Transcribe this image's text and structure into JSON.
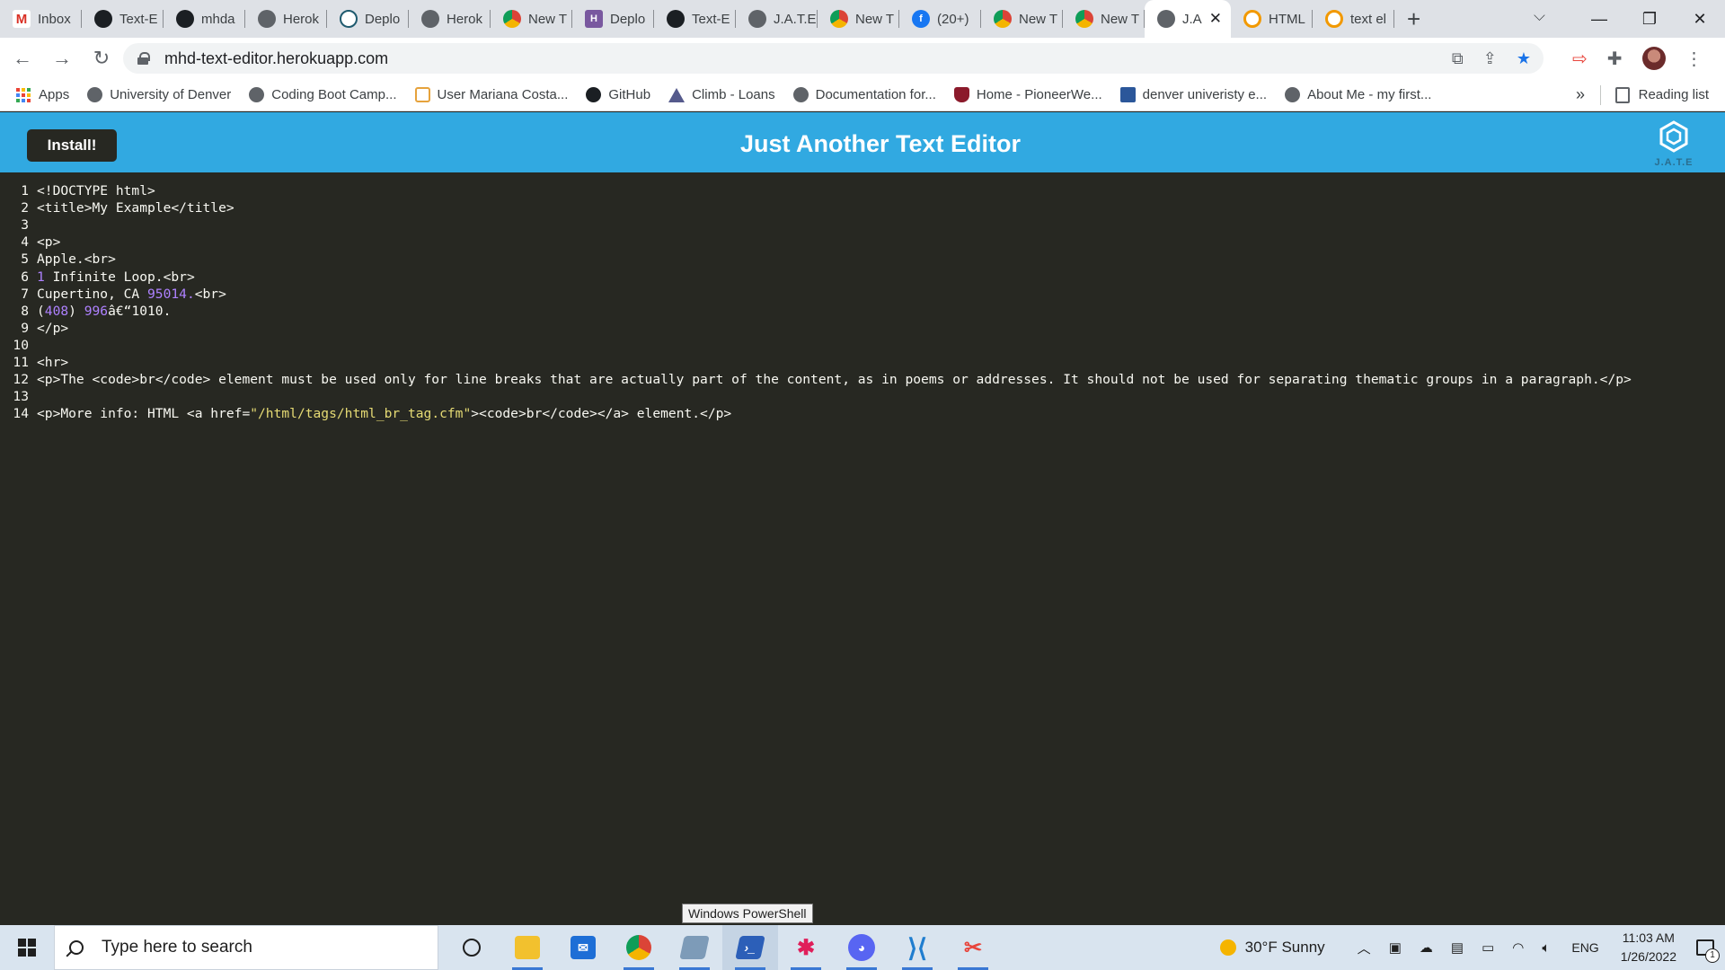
{
  "browser": {
    "tabs": [
      {
        "label": "Inbox",
        "icon": "gmail-icon",
        "fav": "fav-gmail",
        "glyph": "M"
      },
      {
        "label": "Text-E",
        "icon": "github-icon",
        "fav": "fav-github",
        "glyph": ""
      },
      {
        "label": "mhda",
        "icon": "github-icon",
        "fav": "fav-github",
        "glyph": ""
      },
      {
        "label": "Herok",
        "icon": "globe-icon",
        "fav": "fav-globe",
        "glyph": ""
      },
      {
        "label": "Deplo",
        "icon": "netlify-icon",
        "fav": "fav-netlify",
        "glyph": ""
      },
      {
        "label": "Herok",
        "icon": "globe-icon",
        "fav": "fav-globe",
        "glyph": ""
      },
      {
        "label": "New T",
        "icon": "chrome-icon",
        "fav": "fav-chrome",
        "glyph": ""
      },
      {
        "label": "Deplo",
        "icon": "heroku-icon",
        "fav": "fav-heroku",
        "glyph": "H"
      },
      {
        "label": "Text-E",
        "icon": "github-icon",
        "fav": "fav-github",
        "glyph": ""
      },
      {
        "label": "J.A.T.E",
        "icon": "globe-icon",
        "fav": "fav-globe",
        "glyph": ""
      },
      {
        "label": "New T",
        "icon": "chrome-icon",
        "fav": "fav-chrome",
        "glyph": ""
      },
      {
        "label": "(20+)",
        "icon": "facebook-icon",
        "fav": "fav-facebook",
        "glyph": "f"
      },
      {
        "label": "New T",
        "icon": "chrome-icon",
        "fav": "fav-chrome",
        "glyph": ""
      },
      {
        "label": "New T",
        "icon": "chrome-icon",
        "fav": "fav-chrome",
        "glyph": ""
      },
      {
        "label": "J.A",
        "icon": "globe-icon",
        "fav": "fav-globe",
        "glyph": "",
        "active": true
      },
      {
        "label": "HTML",
        "icon": "search-engine-icon",
        "fav": "fav-search",
        "glyph": ""
      },
      {
        "label": "text el",
        "icon": "search-engine-icon",
        "fav": "fav-search",
        "glyph": ""
      }
    ],
    "url": "mhd-text-editor.herokuapp.com",
    "bookmarks": [
      {
        "label": "Apps",
        "icon": "apps-grid-icon",
        "cls": "apps"
      },
      {
        "label": "University of Denver",
        "icon": "globe-icon",
        "cls": ""
      },
      {
        "label": "Coding Boot Camp...",
        "icon": "globe-icon",
        "cls": ""
      },
      {
        "label": "User Mariana Costa...",
        "icon": "stackoverflow-icon",
        "cls": "user"
      },
      {
        "label": "GitHub",
        "icon": "github-icon",
        "cls": "github"
      },
      {
        "label": "Climb - Loans",
        "icon": "climb-icon",
        "cls": "climb"
      },
      {
        "label": "Documentation for...",
        "icon": "globe-icon",
        "cls": ""
      },
      {
        "label": "Home - PioneerWe...",
        "icon": "pioneer-shield-icon",
        "cls": "pioneer"
      },
      {
        "label": "denver univeristy e...",
        "icon": "word-icon",
        "cls": "word"
      },
      {
        "label": "About Me - my first...",
        "icon": "globe-icon",
        "cls": ""
      }
    ],
    "more_bookmarks": "»",
    "reading_list": "Reading list"
  },
  "app": {
    "install_label": "Install!",
    "title": "Just Another Text Editor",
    "logo_text": "J.A.T.E",
    "accent_color": "#31a9e1",
    "editor_bg": "#272822"
  },
  "editor": {
    "lines": [
      {
        "n": "1",
        "segs": [
          {
            "t": "<!DOCTYPE html>"
          }
        ]
      },
      {
        "n": "2",
        "segs": [
          {
            "t": "<title>My Example</title>"
          }
        ]
      },
      {
        "n": "3",
        "segs": []
      },
      {
        "n": "4",
        "segs": [
          {
            "t": "<p>"
          }
        ]
      },
      {
        "n": "5",
        "segs": [
          {
            "t": "Apple.<br>"
          }
        ]
      },
      {
        "n": "6",
        "segs": [
          {
            "t": "1",
            "c": "num"
          },
          {
            "t": " Infinite Loop.<br>"
          }
        ]
      },
      {
        "n": "7",
        "segs": [
          {
            "t": "Cupertino, CA "
          },
          {
            "t": "95014.",
            "c": "num"
          },
          {
            "t": "<br>"
          }
        ]
      },
      {
        "n": "8",
        "segs": [
          {
            "t": "("
          },
          {
            "t": "408",
            "c": "num"
          },
          {
            "t": ") "
          },
          {
            "t": "996",
            "c": "num"
          },
          {
            "t": "â€“1010."
          }
        ]
      },
      {
        "n": "9",
        "segs": [
          {
            "t": "</p>"
          }
        ]
      },
      {
        "n": "10",
        "segs": []
      },
      {
        "n": "11",
        "segs": [
          {
            "t": "<hr>"
          }
        ]
      },
      {
        "n": "12",
        "segs": [
          {
            "t": "<p>The <code>br</code> element must be used only for line breaks that are actually part of the content, as in poems or addresses. It should not be used for separating thematic groups in a paragraph.</p>"
          }
        ]
      },
      {
        "n": "13",
        "segs": []
      },
      {
        "n": "14",
        "segs": [
          {
            "t": "<p>More info: HTML <a href="
          },
          {
            "t": "\"/html/tags/html_br_tag.cfm\"",
            "c": "str"
          },
          {
            "t": "><code>br</code></a> element.</p>"
          }
        ]
      }
    ]
  },
  "tooltip": "Windows PowerShell",
  "taskbar": {
    "search_placeholder": "Type here to search",
    "weather": "30°F  Sunny",
    "language": "ENG",
    "time": "11:03 AM",
    "date": "1/26/2022",
    "notification_count": "1",
    "apps": [
      {
        "name": "cortana-icon",
        "cls": "ico-cortana",
        "glyph": "",
        "running": false
      },
      {
        "name": "file-explorer-icon",
        "cls": "ico-folder",
        "glyph": "",
        "running": true
      },
      {
        "name": "mail-icon",
        "cls": "ico-mail",
        "glyph": "✉",
        "running": false
      },
      {
        "name": "chrome-icon",
        "cls": "ico-chrome",
        "glyph": "",
        "running": true
      },
      {
        "name": "terminal-icon",
        "cls": "ico-terminal",
        "glyph": "",
        "running": true
      },
      {
        "name": "powershell-icon",
        "cls": "ico-ps",
        "glyph": "›_",
        "running": true,
        "focused": true
      },
      {
        "name": "slack-icon",
        "cls": "ico-slack",
        "glyph": "✱",
        "running": true
      },
      {
        "name": "discord-icon",
        "cls": "ico-discord",
        "glyph": "◕",
        "running": true
      },
      {
        "name": "vscode-icon",
        "cls": "ico-vscode",
        "glyph": "⟩⟨",
        "running": true
      },
      {
        "name": "snipping-tool-icon",
        "cls": "ico-snip",
        "glyph": "✂",
        "running": true
      }
    ]
  }
}
